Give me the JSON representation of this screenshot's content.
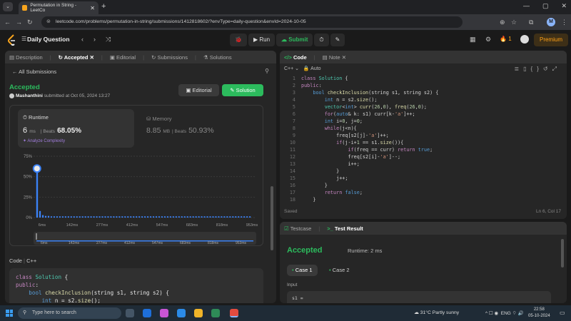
{
  "browser": {
    "tab_title": "Permutation in String - LeetCo",
    "url": "leetcode.com/problems/permutation-in-string/submissions/1412818602/?envType=daily-question&envId=2024-10-05",
    "profile_initial": "M"
  },
  "header": {
    "title": "Daily Question",
    "run_label": "Run",
    "submit_label": "Submit",
    "streak": "1",
    "premium_label": "Premium"
  },
  "left_panel": {
    "tabs": [
      "Description",
      "Accepted",
      "Editorial",
      "Submissions",
      "Solutions"
    ],
    "back_label": "All Submissions",
    "status": "Accepted",
    "author_name": "Mashanthini",
    "submitted_text": "submitted at Oct 05, 2024 13:27",
    "editorial_button": "Editorial",
    "solution_button": "Solution",
    "runtime": {
      "label": "Runtime",
      "value": "6",
      "unit": "ms",
      "beats_label": "Beats",
      "beats": "68.05%",
      "analyze": "Analyze Complexity"
    },
    "memory": {
      "label": "Memory",
      "value": "8.85",
      "unit": "MB",
      "beats_label": "Beats",
      "beats": "50.93%"
    },
    "code_label": "Code",
    "code_lang": "C++",
    "code_preview": [
      "class Solution {",
      "public:",
      "    bool checkInclusion(string s1, string s2) {",
      "        int n = s2.size();"
    ]
  },
  "chart_data": {
    "type": "bar",
    "ylabel": "",
    "y_ticks": [
      "75%",
      "50%",
      "25%",
      "0%"
    ],
    "ylim": [
      0,
      75
    ],
    "x_ticks": [
      "6ms",
      "142ms",
      "277ms",
      "412ms",
      "547ms",
      "683ms",
      "818ms",
      "953ms"
    ],
    "range_ticks": [
      "6ms",
      "142ms",
      "277ms",
      "412ms",
      "547ms",
      "683ms",
      "818ms",
      "953ms"
    ],
    "highlight": {
      "x": "6ms",
      "value": 60
    },
    "values": [
      60,
      8,
      3,
      2,
      2,
      1.5,
      1.5,
      1.5,
      1.5,
      1.5,
      1.5,
      1.5,
      1.5,
      1.5,
      1.5,
      1.5,
      1.5,
      1.5,
      1.5,
      1.5,
      1.5,
      1.5,
      1.5,
      1.5,
      1.5,
      1.5,
      1.5,
      1.5,
      1.5,
      1.5,
      1.5,
      1.5,
      1.5,
      1.5,
      1.5,
      1.5,
      1.5,
      1.5,
      1.5,
      1.5,
      1.5,
      1.5,
      1.5,
      1.5,
      1.5,
      1.5,
      1.5,
      1.5,
      1.5,
      1.5,
      1.5,
      1.5,
      1.5,
      1.5,
      1.5,
      1.5,
      1.5,
      1.5,
      1.5,
      1.5,
      1.5,
      1.5,
      1.5,
      1.5,
      1.5,
      1.5,
      1.5,
      1.5,
      1.5,
      1.5,
      1.5,
      1.5,
      1.5,
      1.5,
      1.5,
      1.5
    ],
    "bar_color": "#3b82f6"
  },
  "editor": {
    "tabs": [
      "Code",
      "Note"
    ],
    "language": "C++",
    "mode": "Auto",
    "line_numbers": [
      "1",
      "2",
      "3",
      "4",
      "5",
      "6",
      "7",
      "8",
      "9",
      "10",
      "11",
      "12",
      "13",
      "14",
      "15",
      "16",
      "17",
      "18"
    ],
    "saved": "Saved",
    "cursor": "Ln 6, Col 17"
  },
  "result": {
    "tabs": [
      "Testcase",
      "Test Result"
    ],
    "status": "Accepted",
    "runtime": "Runtime: 2 ms",
    "cases": [
      "Case 1",
      "Case 2"
    ],
    "input_label": "Input",
    "input_first": "s1 ="
  },
  "taskbar": {
    "search_placeholder": "Type here to search",
    "temperature": "31°C",
    "weather": "Partly sunny",
    "lang": "ENG",
    "time": "22:58",
    "date": "05-10-2024"
  }
}
